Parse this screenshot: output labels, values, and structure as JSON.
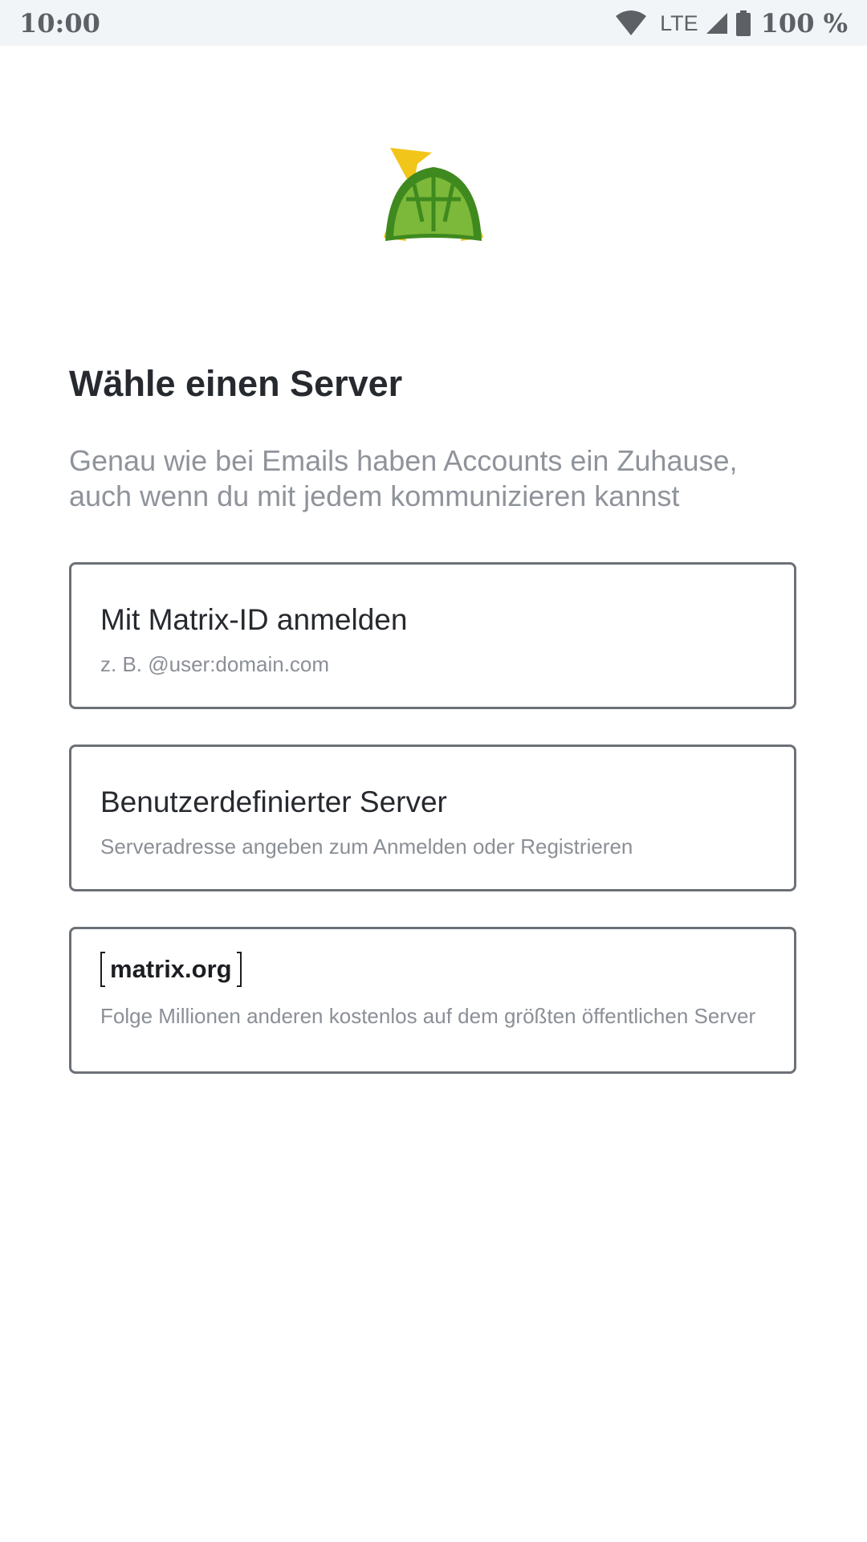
{
  "status_bar": {
    "time": "10:00",
    "network": "LTE",
    "battery": "100 %",
    "icons": [
      "wifi-icon",
      "signal-icon",
      "battery-icon"
    ]
  },
  "logo": {
    "icon": "turtle-logo-icon"
  },
  "header": {
    "title": "Wähle einen Server",
    "subtitle": "Genau wie bei Emails haben Accounts ein Zuhause, auch wenn du mit jedem kommunizieren kannst"
  },
  "options": [
    {
      "title": "Mit Matrix-ID anmelden",
      "description": "z. B. @user:domain.com"
    },
    {
      "title": "Benutzerdefinierter Server",
      "description": "Serveradresse angeben zum Anmelden oder Registrieren"
    },
    {
      "title": "matrix.org",
      "description": "Folge Millionen anderen kostenlos auf dem größten öffentlichen Server"
    }
  ],
  "colors": {
    "text_primary": "#26292e",
    "text_secondary": "#8f939a",
    "card_border": "#6c7077",
    "status_bar_bg": "#f2f5f8"
  }
}
